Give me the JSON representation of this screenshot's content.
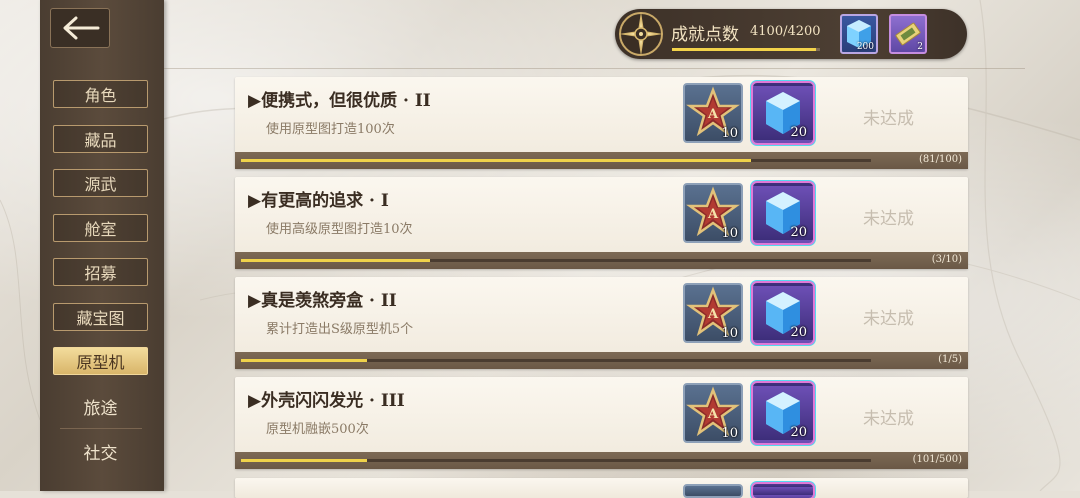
{
  "header": {
    "back_icon": "arrow-left-icon",
    "points_label": "成就点数",
    "points_value": "4100/4200",
    "points_progress": 0.976,
    "currencies": [
      {
        "icon": "blue-crystal-icon",
        "count": "200"
      },
      {
        "icon": "gold-ticket-icon",
        "count": "2"
      }
    ]
  },
  "sidebar": {
    "items": [
      {
        "label": "角色"
      },
      {
        "label": "藏品"
      },
      {
        "label": "源武"
      },
      {
        "label": "舱室"
      },
      {
        "label": "招募"
      },
      {
        "label": "藏宝图"
      },
      {
        "label": "原型机",
        "active": true
      },
      {
        "label": "旅途"
      },
      {
        "label": "社交"
      }
    ]
  },
  "achievements": [
    {
      "title": "▶便携式，但很优质 · II",
      "desc": "使用原型图打造100次",
      "rewards": [
        {
          "icon": "a-star-badge-icon",
          "count": "10"
        },
        {
          "icon": "blue-crystal-icon",
          "count": "20"
        }
      ],
      "status": "未达成",
      "progress_text": "(81/100)",
      "progress": 0.81
    },
    {
      "title": "▶有更高的追求 · I",
      "desc": "使用高级原型图打造10次",
      "rewards": [
        {
          "icon": "a-star-badge-icon",
          "count": "10"
        },
        {
          "icon": "blue-crystal-icon",
          "count": "20"
        }
      ],
      "status": "未达成",
      "progress_text": "(3/10)",
      "progress": 0.3
    },
    {
      "title": "▶真是羡煞旁盒 · II",
      "desc": "累计打造出S级原型机5个",
      "rewards": [
        {
          "icon": "a-star-badge-icon",
          "count": "10"
        },
        {
          "icon": "blue-crystal-icon",
          "count": "20"
        }
      ],
      "status": "未达成",
      "progress_text": "(1/5)",
      "progress": 0.2
    },
    {
      "title": "▶外壳闪闪发光 · III",
      "desc": "原型机融嵌500次",
      "rewards": [
        {
          "icon": "a-star-badge-icon",
          "count": "10"
        },
        {
          "icon": "blue-crystal-icon",
          "count": "20"
        }
      ],
      "status": "未达成",
      "progress_text": "(101/500)",
      "progress": 0.2
    }
  ],
  "colors": {
    "sidebar_bg": "#4f4134",
    "active_tab": "#e8c57d",
    "progress_fill": "#efd24a",
    "card_footer": "#75624f"
  }
}
